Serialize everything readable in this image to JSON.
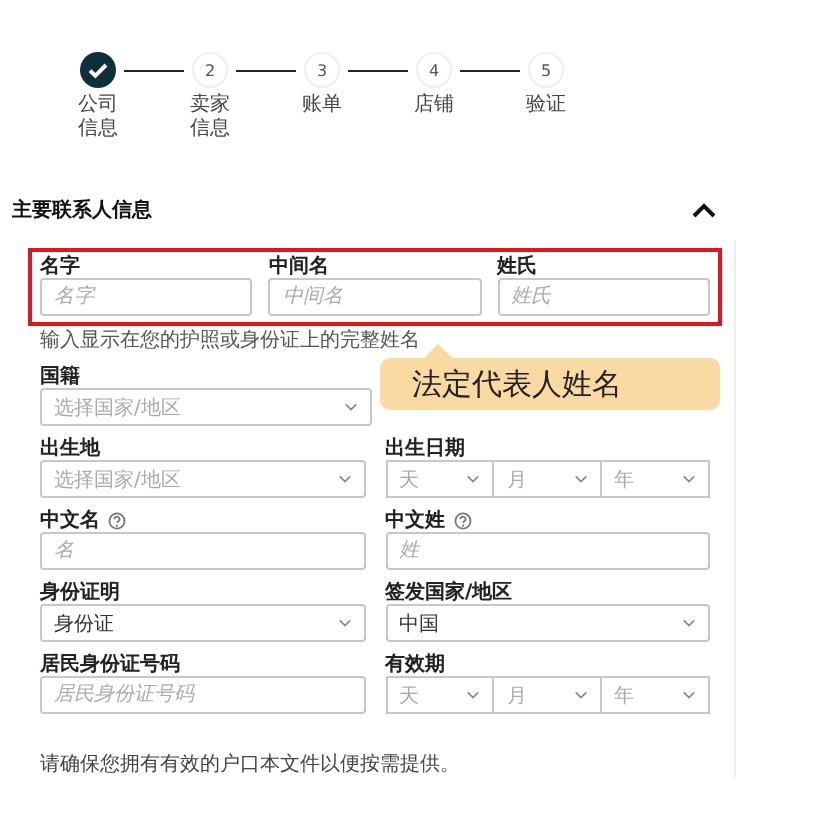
{
  "steps": [
    {
      "label": "公司信息",
      "done": true
    },
    {
      "number": "2",
      "label": "卖家信息",
      "done": false
    },
    {
      "number": "3",
      "label": "账单",
      "done": false
    },
    {
      "number": "4",
      "label": "店铺",
      "done": false
    },
    {
      "number": "5",
      "label": "验证",
      "done": false
    }
  ],
  "section": {
    "title": "主要联系人信息",
    "expanded": true
  },
  "name_fields": {
    "highlighted": true,
    "fields": [
      {
        "label": "名字",
        "placeholder": "名字"
      },
      {
        "label": "中间名",
        "placeholder": "中间名"
      },
      {
        "label": "姓氏",
        "placeholder": "姓氏"
      }
    ]
  },
  "name_hint": "输入显示在您的护照或身份证上的完整姓名",
  "callout": {
    "text": "法定代表人姓名"
  },
  "rows": [
    [
      {
        "label": "国籍",
        "kind": "select",
        "placeholder": "选择国家/地区"
      }
    ],
    [
      {
        "label": "出生地",
        "kind": "select",
        "placeholder": "选择国家/地区"
      },
      {
        "label": "出生日期",
        "kind": "date",
        "parts": [
          "天",
          "月",
          "年"
        ]
      }
    ],
    [
      {
        "label": "中文名",
        "kind": "input",
        "help": true,
        "placeholder": "名"
      },
      {
        "label": "中文姓",
        "kind": "input",
        "help": true,
        "placeholder": "姓"
      }
    ],
    [
      {
        "label": "身份证明",
        "kind": "select",
        "value": "身份证"
      },
      {
        "label": "签发国家/地区",
        "kind": "select",
        "value": "中国"
      }
    ],
    [
      {
        "label": "居民身份证号码",
        "kind": "input",
        "placeholder": "居民身份证号码"
      },
      {
        "label": "有效期",
        "kind": "date",
        "parts": [
          "天",
          "月",
          "年"
        ]
      }
    ]
  ],
  "note": "请确保您拥有有效的户口本文件以便按需提供。"
}
